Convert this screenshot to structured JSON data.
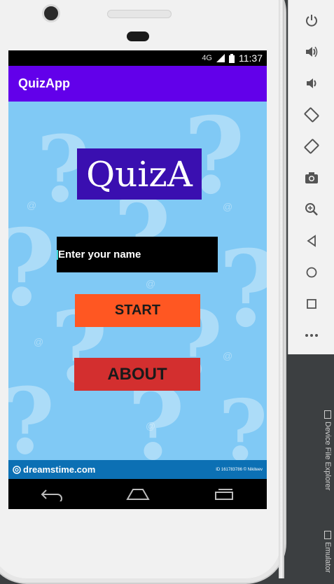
{
  "status_bar": {
    "network": "4G",
    "time": "11:37"
  },
  "app_bar": {
    "title": "QuizApp"
  },
  "logo": {
    "text": "QuizA"
  },
  "name_field": {
    "placeholder": "Enter your name"
  },
  "buttons": {
    "start": "START",
    "about": "ABOUT"
  },
  "watermark": {
    "brand": "dreamstime.com",
    "id_text": "ID 161783786 © Nikiteev"
  },
  "side_toolbar": {
    "tools": [
      "power-icon",
      "volume-up-icon",
      "volume-down-icon",
      "rotate-left-icon",
      "rotate-right-icon",
      "camera-icon",
      "zoom-icon",
      "back-icon",
      "home-icon",
      "overview-icon",
      "more-icon"
    ]
  },
  "ide_tabs": {
    "device_file_explorer": "Device File Explorer",
    "emulator": "Emulator"
  },
  "colors": {
    "app_bar": "#6200ea",
    "background": "#80c9f5",
    "logo_bg": "#3a0fb0",
    "start_button": "#ff5722",
    "about_button": "#d32f2f",
    "watermark": "#0c70b4"
  }
}
